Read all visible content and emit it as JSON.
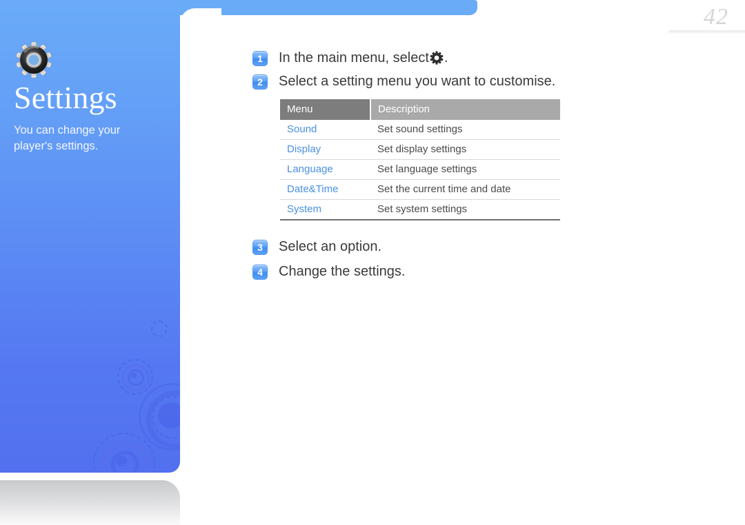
{
  "page": {
    "number": "42"
  },
  "sidebar": {
    "icon": "gear-icon",
    "title": "Settings",
    "description": "You can change your player's settings."
  },
  "steps": [
    {
      "number": "1",
      "text_before": "In the main menu, select",
      "icon": "gear-icon",
      "text_after": "."
    },
    {
      "number": "2",
      "text_before": "Select a setting menu you want to customise.",
      "icon": "",
      "text_after": ""
    },
    {
      "number": "3",
      "text_before": "Select an option.",
      "icon": "",
      "text_after": ""
    },
    {
      "number": "4",
      "text_before": "Change the settings.",
      "icon": "",
      "text_after": ""
    }
  ],
  "table": {
    "headers": [
      "Menu",
      "Description"
    ],
    "rows": [
      {
        "menu": "Sound",
        "description": "Set sound settings"
      },
      {
        "menu": "Display",
        "description": "Set display settings"
      },
      {
        "menu": "Language",
        "description": "Set language settings"
      },
      {
        "menu": "Date&Time",
        "description": "Set the current time and date"
      },
      {
        "menu": "System",
        "description": "Set system settings"
      }
    ]
  },
  "colors": {
    "sidebar_top": "#6aabf8",
    "sidebar_bottom": "#5270ef",
    "link_blue": "#4a90e2",
    "header_menu_gray": "#7d7d7d",
    "header_desc_gray": "#a9a9a9",
    "page_number_gray": "#d6d6d6"
  }
}
